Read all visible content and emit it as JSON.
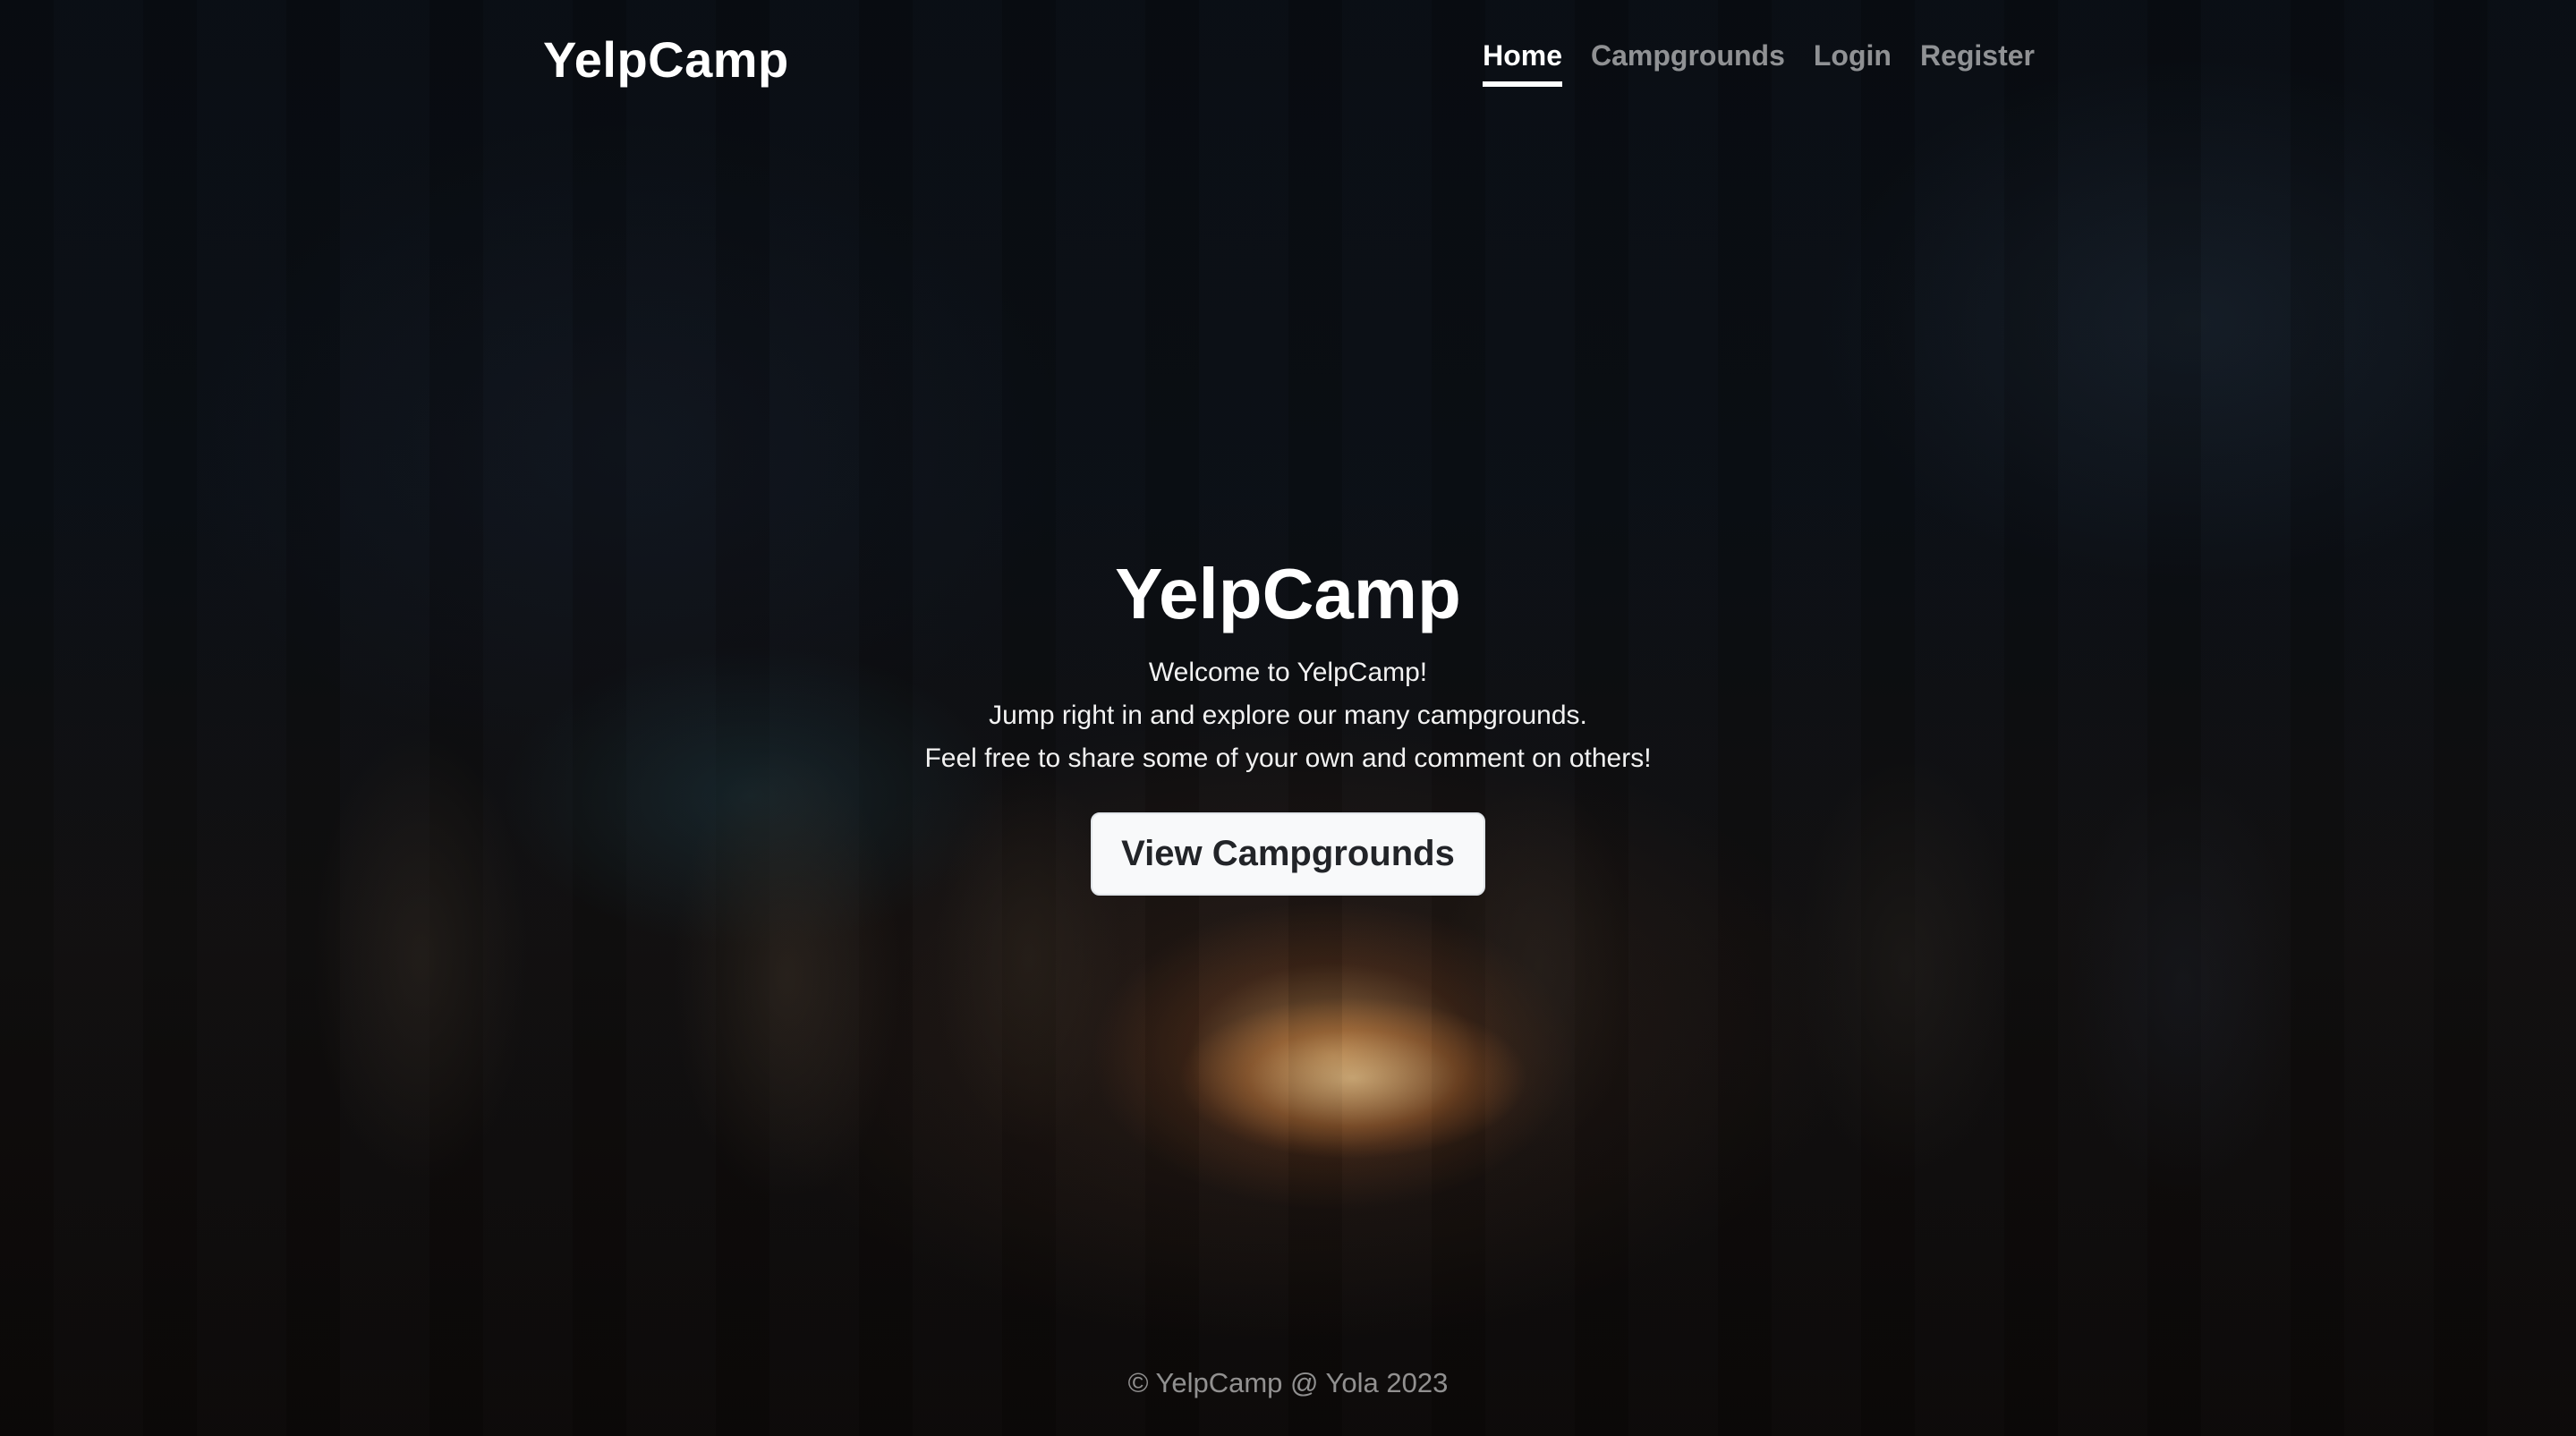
{
  "header": {
    "brand": "YelpCamp",
    "nav": [
      {
        "label": "Home",
        "active": true
      },
      {
        "label": "Campgrounds",
        "active": false
      },
      {
        "label": "Login",
        "active": false
      },
      {
        "label": "Register",
        "active": false
      }
    ]
  },
  "hero": {
    "title": "YelpCamp",
    "lines": [
      "Welcome to YelpCamp!",
      "Jump right in and explore our many campgrounds.",
      "Feel free to share some of your own and comment on others!"
    ],
    "button_label": "View Campgrounds"
  },
  "footer": {
    "text": "© YelpCamp @ Yola 2023"
  }
}
